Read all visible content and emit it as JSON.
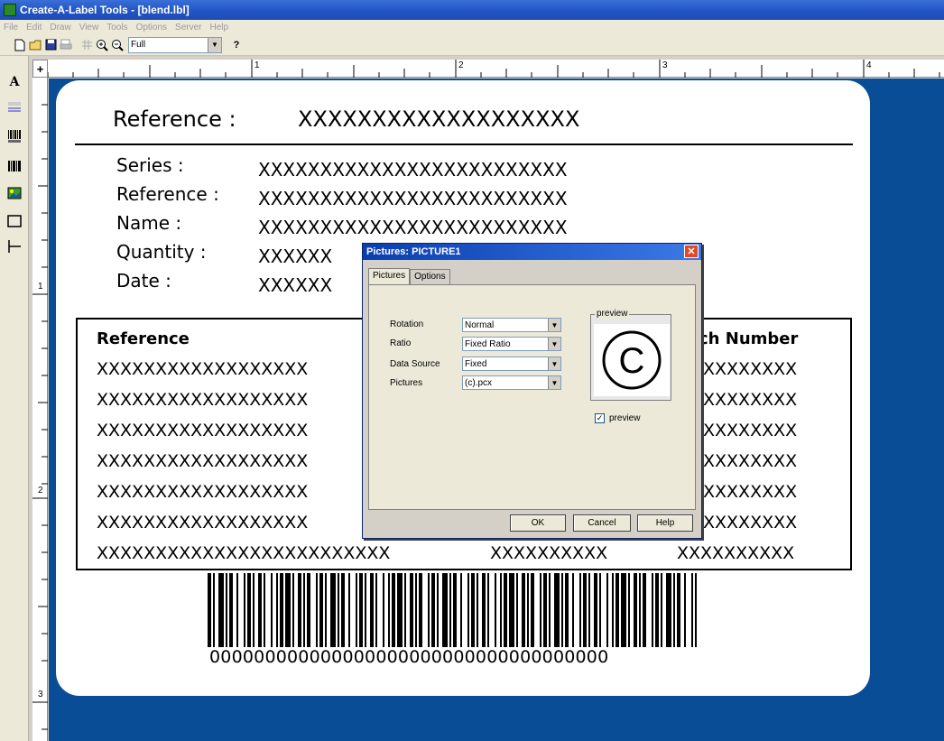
{
  "window": {
    "title": "Create-A-Label Tools - [blend.lbl]"
  },
  "menu": [
    "File",
    "Edit",
    "Draw",
    "View",
    "Tools",
    "Options",
    "Server",
    "Help"
  ],
  "toolbar": {
    "zoom_value": "Full",
    "help_glyph": "?"
  },
  "palette": {
    "text_glyph": "A"
  },
  "rulers": {
    "top": [
      "1",
      "2",
      "3",
      "4"
    ],
    "left": [
      "1",
      "2",
      "3"
    ],
    "corner_glyph": "+"
  },
  "label": {
    "header_label": "Reference :",
    "header_value": "XXXXXXXXXXXXXXXXXXX",
    "fields": [
      {
        "label": "Series :",
        "value": "XXXXXXXXXXXXXXXXXXXXXXXXX"
      },
      {
        "label": "Reference :",
        "value": "XXXXXXXXXXXXXXXXXXXXXXXXX"
      },
      {
        "label": "Name :",
        "value": "XXXXXXXXXXXXXXXXXXXXXXXXX"
      },
      {
        "label": "Quantity :",
        "value": "XXXXXX"
      },
      {
        "label": "Date :",
        "value": "XXXXXX"
      }
    ],
    "table": {
      "col_left": "Reference",
      "col_right": "ch Number",
      "rows_left": [
        "XXXXXXXXXXXXXXXXXX",
        "XXXXXXXXXXXXXXXXXX",
        "XXXXXXXXXXXXXXXXXX",
        "XXXXXXXXXXXXXXXXXX",
        "XXXXXXXXXXXXXXXXXX",
        "XXXXXXXXXXXXXXXXXX"
      ],
      "rows_right": [
        "XXXXXXXX",
        "XXXXXXXX",
        "XXXXXXXX",
        "XXXXXXXX",
        "XXXXXXXX",
        "XXXXXXXX"
      ],
      "last_row": [
        "XXXXXXXXXXXXXXXXXXXXXXXXX",
        "XXXXXXXXXX",
        "XXXXXXXXXX"
      ]
    },
    "barcode_text": "000000000000000000000000000000000000"
  },
  "dialog": {
    "title": "Pictures: PICTURE1",
    "close_glyph": "✕",
    "tabs": [
      "Pictures",
      "Options"
    ],
    "fields": [
      {
        "label": "Rotation",
        "value": "Normal"
      },
      {
        "label": "Ratio",
        "value": "Fixed Ratio"
      },
      {
        "label": "Data Source",
        "value": "Fixed"
      },
      {
        "label": "Pictures",
        "value": "(c).pcx"
      }
    ],
    "preview_legend": "preview",
    "preview_symbol": "C",
    "preview_check_label": "preview",
    "preview_checked": "✓",
    "buttons": {
      "ok": "OK",
      "cancel": "Cancel",
      "help": "Help"
    }
  },
  "colors": {
    "canvas_bg": "#0a4d97",
    "titlebar": "#2257c7",
    "dialog_close": "#e04a2a"
  }
}
